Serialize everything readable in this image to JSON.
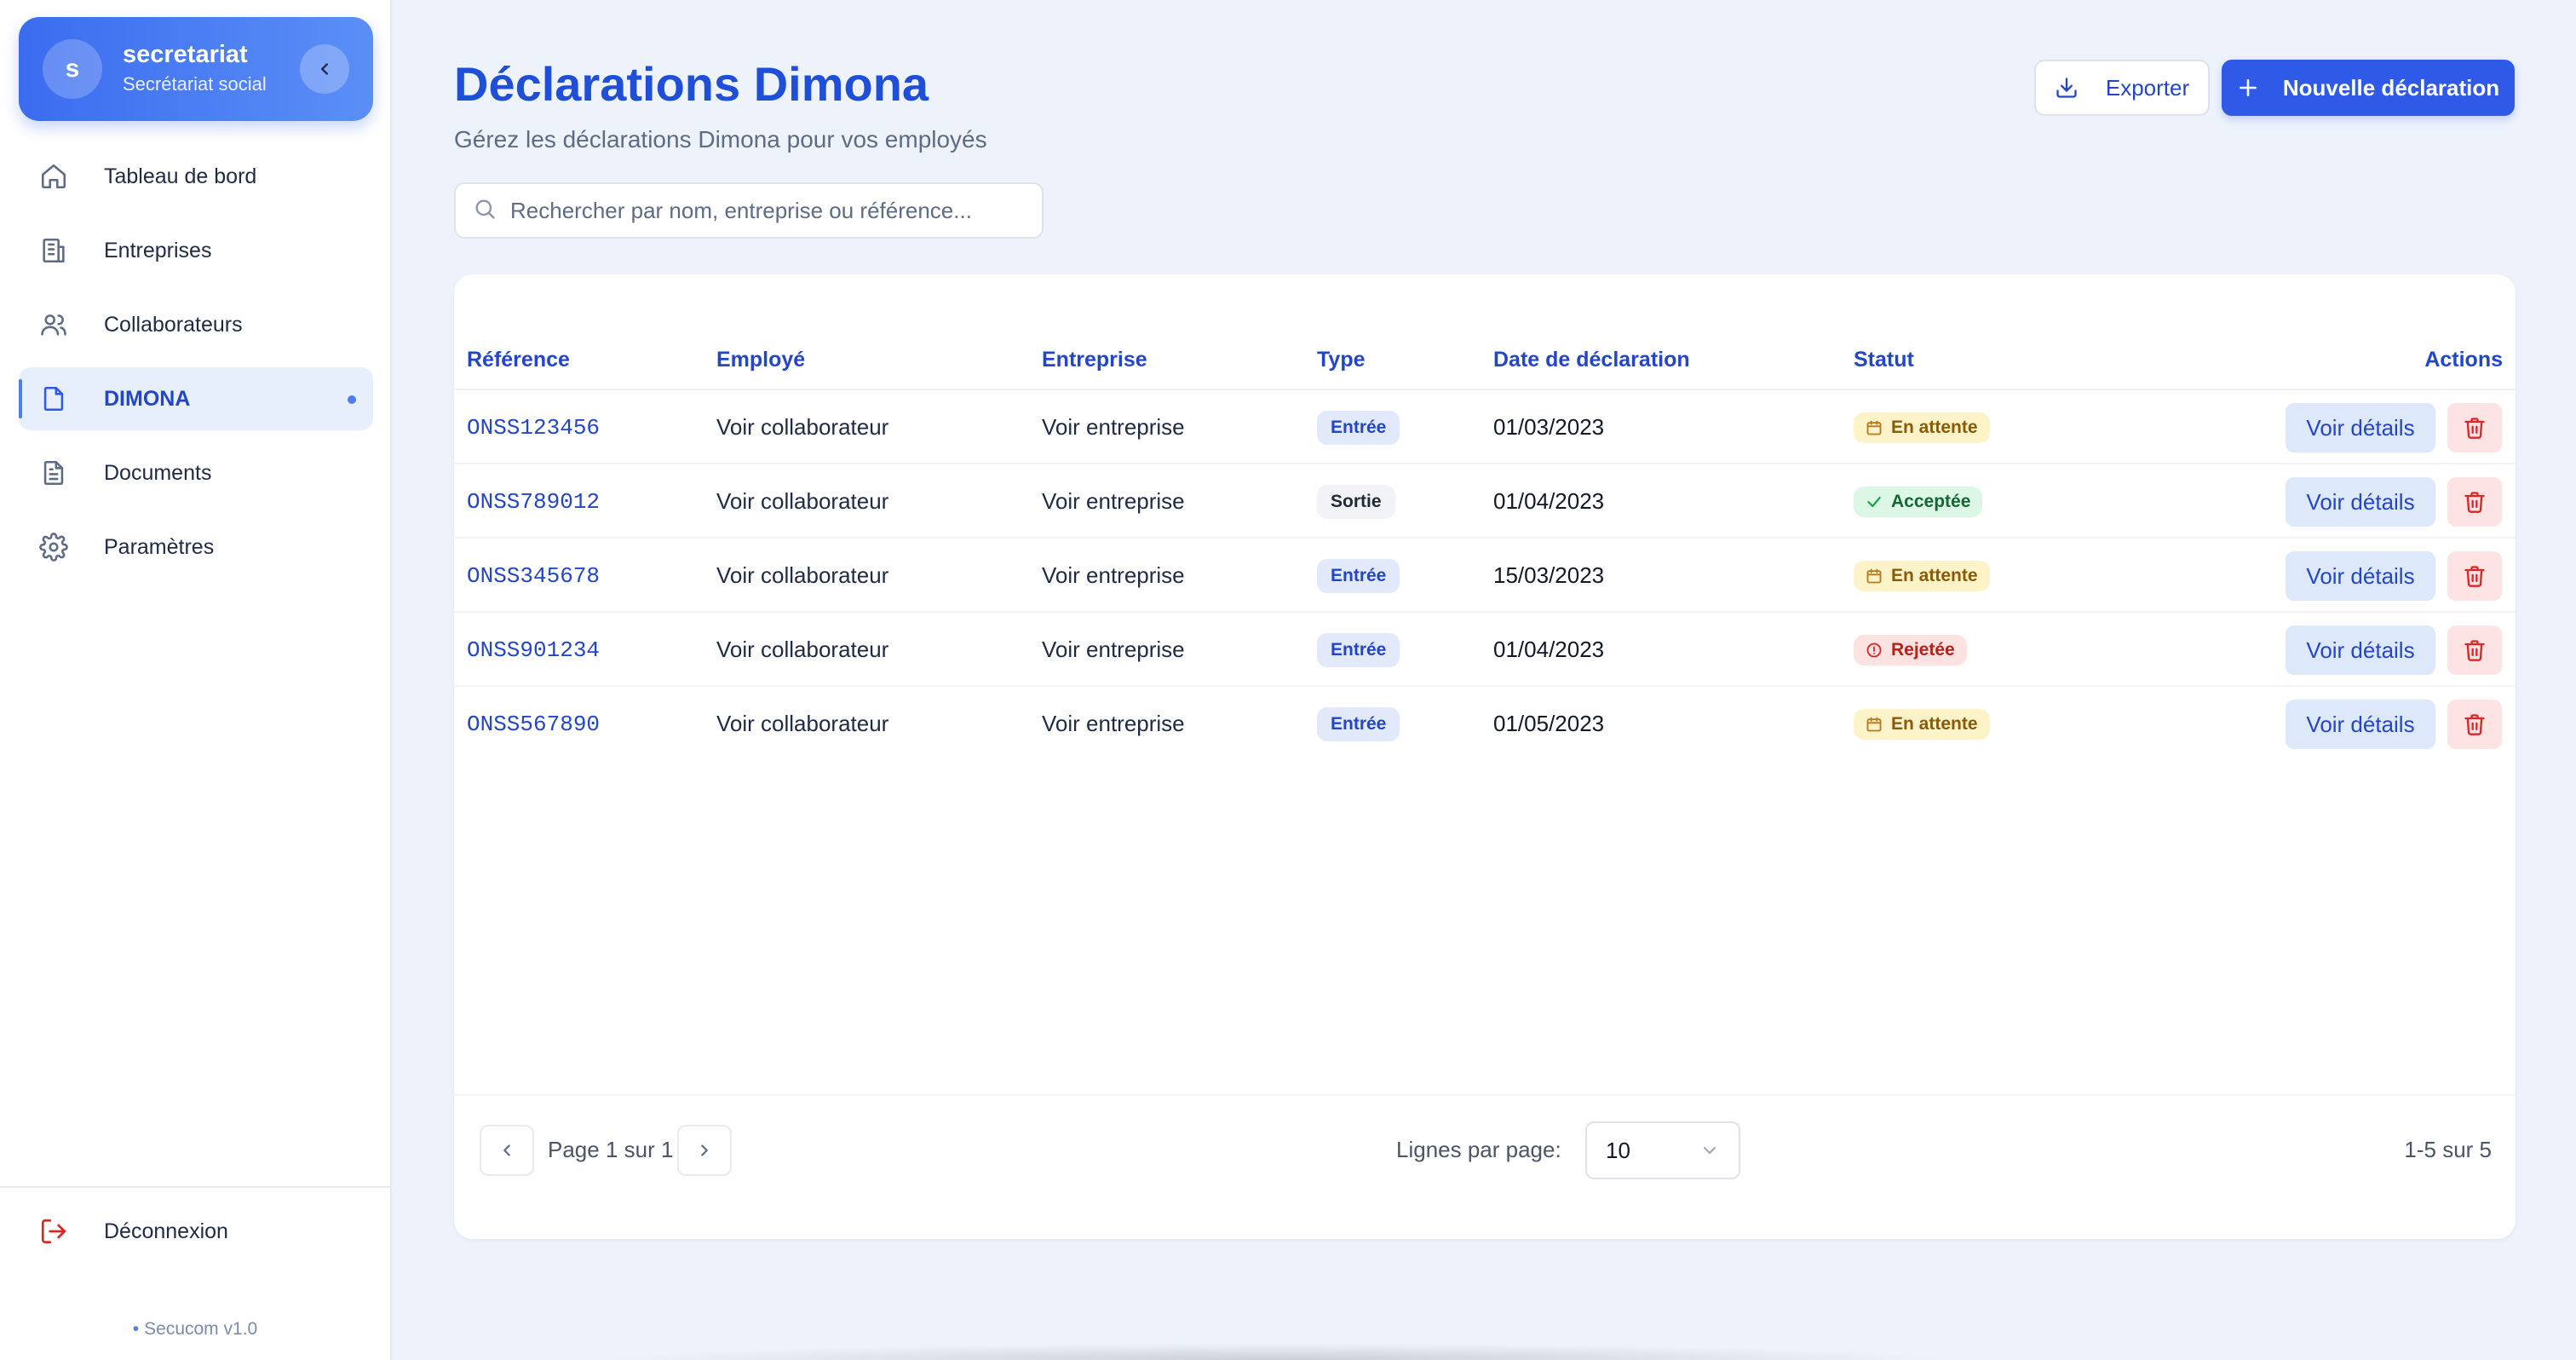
{
  "sidebar": {
    "account": {
      "initial": "s",
      "name": "secretariat",
      "role": "Secrétariat social"
    },
    "items": [
      {
        "label": "Tableau de bord",
        "icon": "home-icon"
      },
      {
        "label": "Entreprises",
        "icon": "building-icon"
      },
      {
        "label": "Collaborateurs",
        "icon": "users-icon"
      },
      {
        "label": "DIMONA",
        "icon": "file-icon",
        "active": true
      },
      {
        "label": "Documents",
        "icon": "document-icon"
      },
      {
        "label": "Paramètres",
        "icon": "gear-icon"
      }
    ],
    "logout_label": "Déconnexion",
    "version": "Secucom v1.0"
  },
  "header": {
    "title": "Déclarations Dimona",
    "subtitle": "Gérez les déclarations Dimona pour vos employés",
    "export_label": "Exporter",
    "new_label": "Nouvelle déclaration"
  },
  "search": {
    "placeholder": "Rechercher par nom, entreprise ou référence...",
    "value": ""
  },
  "table": {
    "columns": [
      "Référence",
      "Employé",
      "Entreprise",
      "Type",
      "Date de déclaration",
      "Statut",
      "Actions"
    ],
    "rows": [
      {
        "ref": "ONSS123456",
        "employee": "Voir collaborateur",
        "company": "Voir entreprise",
        "type": "Entrée",
        "date": "01/03/2023",
        "status": "En attente"
      },
      {
        "ref": "ONSS789012",
        "employee": "Voir collaborateur",
        "company": "Voir entreprise",
        "type": "Sortie",
        "date": "01/04/2023",
        "status": "Acceptée"
      },
      {
        "ref": "ONSS345678",
        "employee": "Voir collaborateur",
        "company": "Voir entreprise",
        "type": "Entrée",
        "date": "15/03/2023",
        "status": "En attente"
      },
      {
        "ref": "ONSS901234",
        "employee": "Voir collaborateur",
        "company": "Voir entreprise",
        "type": "Entrée",
        "date": "01/04/2023",
        "status": "Rejetée"
      },
      {
        "ref": "ONSS567890",
        "employee": "Voir collaborateur",
        "company": "Voir entreprise",
        "type": "Entrée",
        "date": "01/05/2023",
        "status": "En attente"
      }
    ],
    "details_label": "Voir détails"
  },
  "pagination": {
    "page_text": "Page 1 sur 1",
    "rows_label": "Lignes par page:",
    "rows_value": "10",
    "range_text": "1-5 sur 5"
  },
  "colors": {
    "accent": "#2f5ae8",
    "title": "#1f4fd6",
    "pending": "#fdf3c8",
    "accepted": "#dcf7e6",
    "rejected": "#fde2e2",
    "danger": "#dc2626"
  }
}
